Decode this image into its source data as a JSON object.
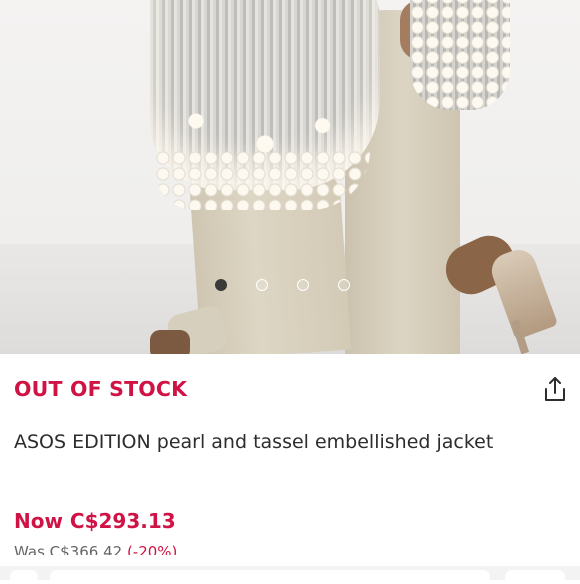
{
  "product_image": {
    "alt": "ASOS EDITION pearl and tassel embellished jacket",
    "carousel_dots": [
      {
        "active": true
      },
      {
        "active": false
      },
      {
        "active": false
      },
      {
        "active": false
      }
    ],
    "carousel_position": 1,
    "carousel_total": 4
  },
  "stock_status": "OUT OF STOCK",
  "share_icon": "share-icon",
  "product": {
    "title": "ASOS EDITION pearl and tassel embellished jacket",
    "price_now": "Now C$293.13",
    "price_was": "Was C$366.42",
    "discount": "(-20%)"
  },
  "colors": {
    "accent": "#d01345",
    "text": "#2d2d2d",
    "dot_active": "#3a3a3a"
  }
}
